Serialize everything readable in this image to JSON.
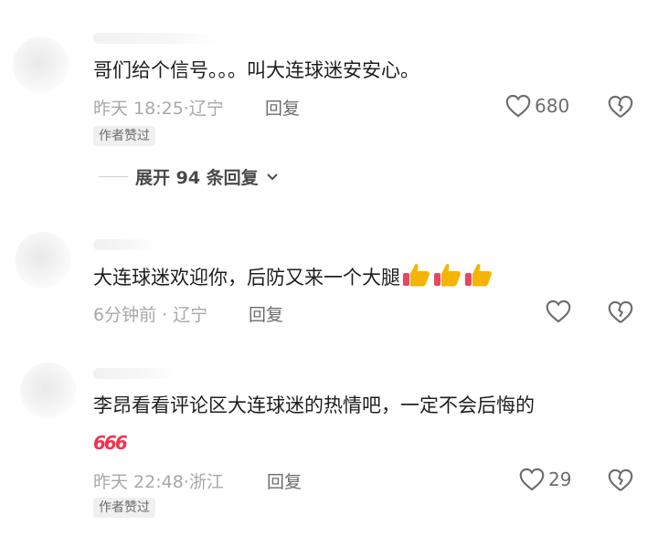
{
  "comments": [
    {
      "text": "哥们给个信号。。。叫大连球迷安安心。",
      "time": "昨天 18:25",
      "location": "辽宁",
      "reply_label": "回复",
      "likes": "680",
      "badge": "作者赞过",
      "expand_label": "展开 94 条回复"
    },
    {
      "text": "大连球迷欢迎你，后防又来一个大腿",
      "time": "6分钟前",
      "location": "辽宁",
      "reply_label": "回复",
      "likes": "",
      "emoji": "thumbs-up-icon x3"
    },
    {
      "text": "李昂看看评论区大连球迷的热情吧，一定不会后悔的",
      "sticker": "666",
      "time": "昨天 22:48",
      "location": "浙江",
      "reply_label": "回复",
      "likes": "29",
      "badge": "作者赞过"
    }
  ],
  "separator": "·",
  "colors": {
    "text": "#1f1f1f",
    "meta": "#a8a8a8",
    "action": "#6c6c6c",
    "badge_bg": "#f0f0f0",
    "sticker": "#f0334d",
    "thumb": "#f5b400"
  }
}
